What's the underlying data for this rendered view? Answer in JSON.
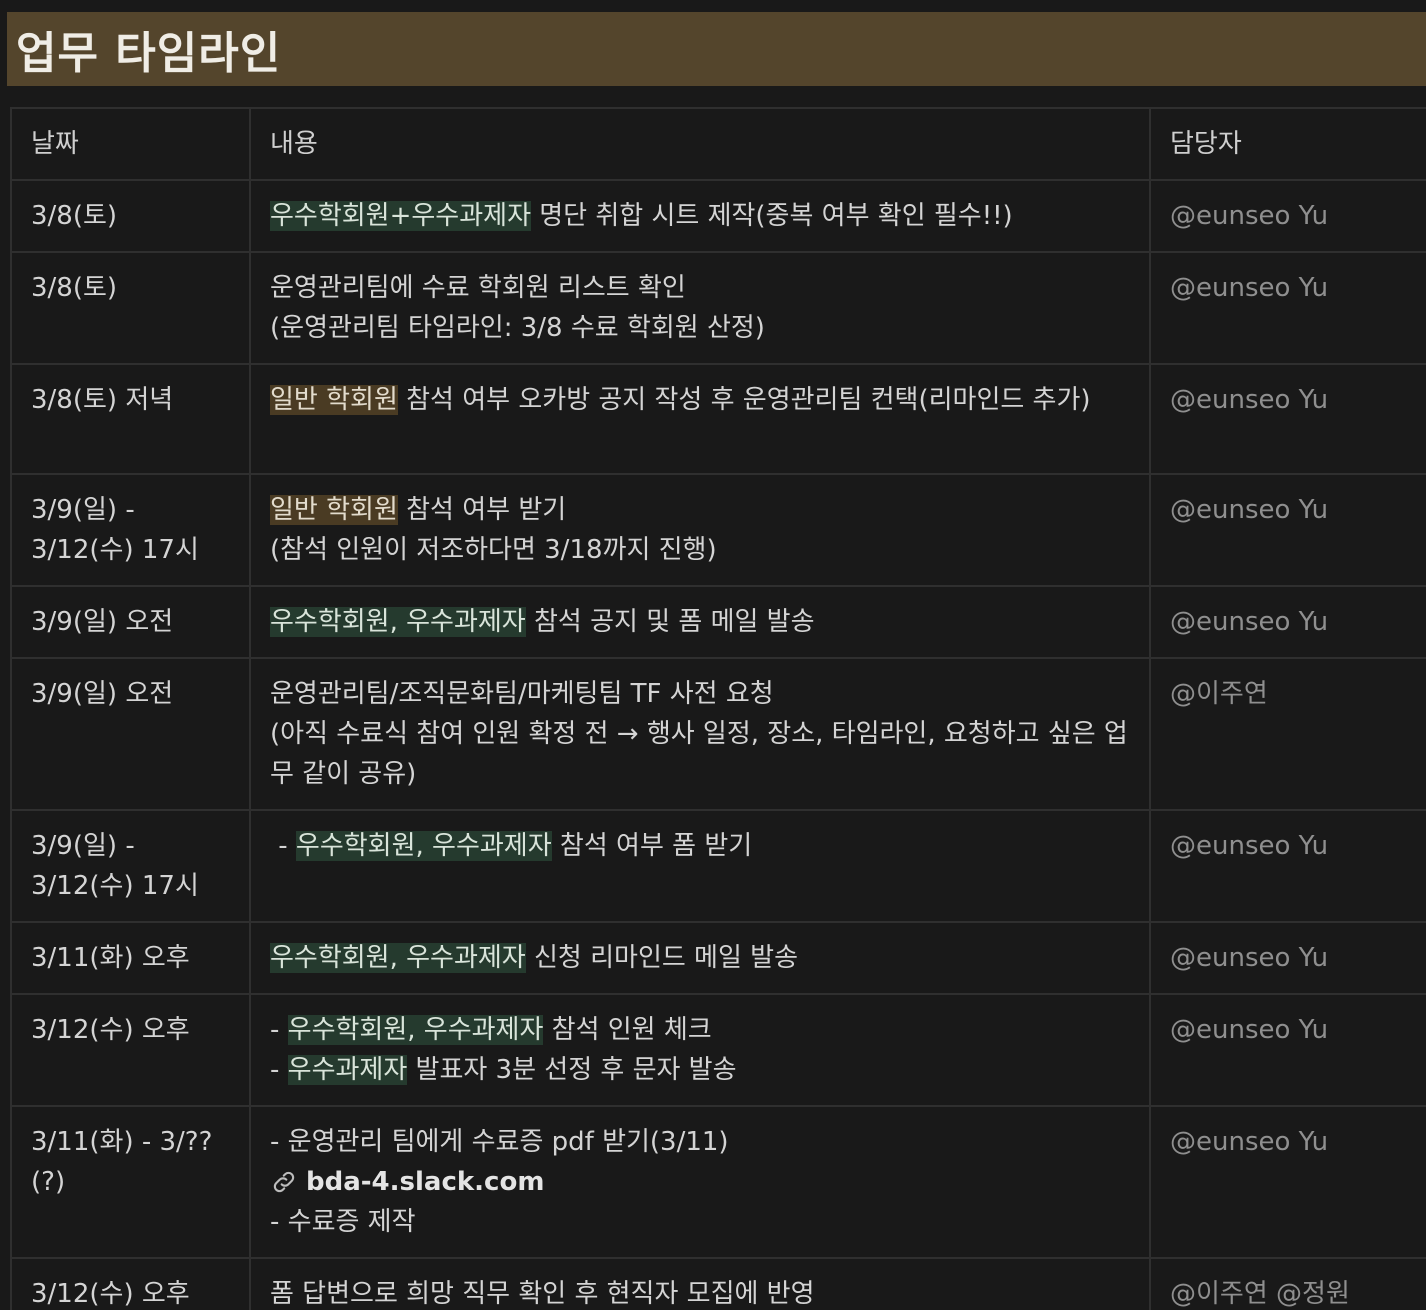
{
  "page": {
    "title": "업무 타임라인"
  },
  "table": {
    "headers": {
      "date": "날짜",
      "content": "내용",
      "person": "담당자"
    },
    "rows": [
      {
        "date": "3/8(토)",
        "lines": [
          [
            {
              "text": "우수학회원+우수과제자",
              "hl": "green"
            },
            {
              "text": " 명단 취합 시트 제작(중복 여부 확인 필수!!)"
            }
          ]
        ],
        "person": "@eunseo Yu"
      },
      {
        "date": "3/8(토)",
        "lines": [
          [
            {
              "text": "운영관리팀에 수료 학회원 리스트 확인"
            }
          ],
          [
            {
              "text": "(운영관리팀 타임라인: 3/8 수료 학회원 산정)"
            }
          ]
        ],
        "person": "@eunseo Yu"
      },
      {
        "date": "3/8(토) 저녁",
        "lines": [
          [
            {
              "text": "일반 학회원",
              "hl": "brown"
            },
            {
              "text": " 참석 여부 오카방 공지 작성 후 운영관리팀 컨택(리마인드 추가)"
            }
          ]
        ],
        "person": "@eunseo Yu"
      },
      {
        "date": "3/9(일) - 3/12(수) 17시",
        "lines": [
          [
            {
              "text": "일반 학회원",
              "hl": "brown"
            },
            {
              "text": " 참석 여부 받기"
            }
          ],
          [
            {
              "text": "(참석 인원이 저조하다면 3/18까지 진행)"
            }
          ]
        ],
        "person": "@eunseo Yu"
      },
      {
        "date": "3/9(일) 오전",
        "lines": [
          [
            {
              "text": "우수학회원, 우수과제자",
              "hl": "green"
            },
            {
              "text": " 참석 공지 및 폼 메일 발송"
            }
          ]
        ],
        "person": "@eunseo Yu"
      },
      {
        "date": "3/9(일) 오전",
        "lines": [
          [
            {
              "text": "운영관리팀/조직문화팀/마케팅팀 TF 사전 요청"
            }
          ],
          [
            {
              "text": "(아직 수료식 참여 인원 확정 전 → 행사 일정, 장소, 타임라인, 요청하고 싶은 업무 같이 공유)"
            }
          ]
        ],
        "person": "@이주연"
      },
      {
        "date": "3/9(일) - 3/12(수) 17시",
        "lines": [
          [
            {
              "text": " - "
            },
            {
              "text": "우수학회원, 우수과제자",
              "hl": "green"
            },
            {
              "text": " 참석 여부 폼 받기"
            }
          ]
        ],
        "person": "@eunseo Yu"
      },
      {
        "date": "3/11(화) 오후",
        "lines": [
          [
            {
              "text": "우수학회원, 우수과제자",
              "hl": "green"
            },
            {
              "text": " 신청 리마인드 메일 발송"
            }
          ]
        ],
        "person": "@eunseo Yu"
      },
      {
        "date": "3/12(수) 오후",
        "lines": [
          [
            {
              "text": "- "
            },
            {
              "text": "우수학회원, 우수과제자",
              "hl": "green"
            },
            {
              "text": " 참석 인원 체크"
            }
          ],
          [
            {
              "text": "- "
            },
            {
              "text": "우수과제자",
              "hl": "green"
            },
            {
              "text": " 발표자 3분 선정 후 문자 발송"
            }
          ]
        ],
        "person": "@eunseo Yu"
      },
      {
        "date": "3/11(화) - 3/??(?)",
        "lines": [
          [
            {
              "text": "- 운영관리 팀에게 수료증 pdf 받기(3/11)"
            }
          ],
          [
            {
              "text": "bda-4.slack.com",
              "link": true
            }
          ],
          [
            {
              "text": "- 수료증 제작"
            }
          ]
        ],
        "person": "@eunseo Yu"
      },
      {
        "date": "3/12(수) 오후",
        "lines": [
          [
            {
              "text": "폼 답변으로 희망 직무 확인 후 현직자 모집에 반영"
            }
          ]
        ],
        "person": "@이주연 @정원"
      }
    ]
  },
  "icons": {
    "link": "link-icon"
  },
  "colors": {
    "heading_bg": "#54452c",
    "highlight_green": "#253a2e",
    "highlight_brown": "#4a3b23",
    "page_bg": "#191919"
  }
}
